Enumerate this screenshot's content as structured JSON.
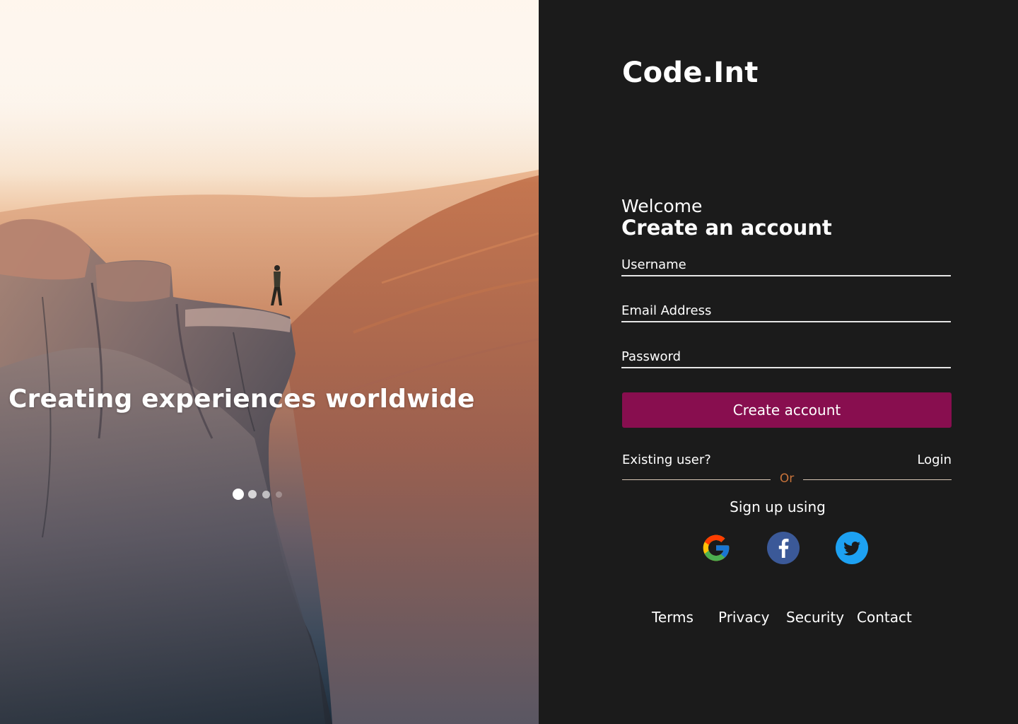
{
  "hero": {
    "tagline": "Creating experiences worldwide",
    "carousel": {
      "slide_count": 4,
      "active_index": 0
    }
  },
  "brand": {
    "logo": "Code.Int"
  },
  "form": {
    "welcome": "Welcome",
    "heading": "Create an account",
    "username_placeholder": "Username",
    "email_placeholder": "Email Address",
    "password_placeholder": "Password",
    "submit_label": "Create account"
  },
  "existing": {
    "prompt": "Existing user?",
    "login_label": "Login"
  },
  "divider": {
    "label": "Or"
  },
  "social": {
    "heading": "Sign up using",
    "providers": [
      {
        "name": "google",
        "icon": "google-icon"
      },
      {
        "name": "facebook",
        "icon": "facebook-icon",
        "color": "#3b5998"
      },
      {
        "name": "twitter",
        "icon": "twitter-icon",
        "color": "#1da1f2"
      }
    ]
  },
  "footer": {
    "links": [
      "Terms",
      "Privacy",
      "Security",
      "Contact"
    ]
  },
  "colors": {
    "panel_background": "#1b1b1b",
    "accent": "#880e4f",
    "divider_text": "#c8733a"
  }
}
